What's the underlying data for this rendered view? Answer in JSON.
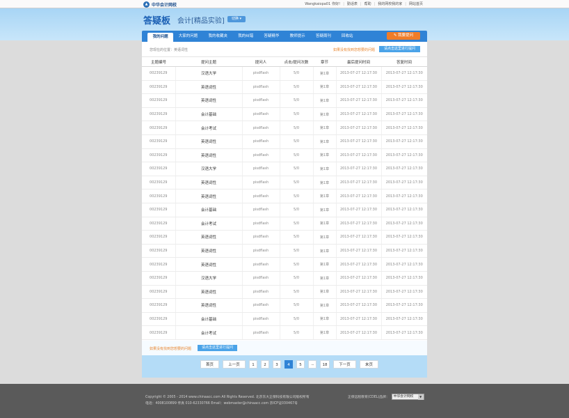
{
  "topbar": {
    "logo_text": "中华会计网校",
    "username": "Wangkaiopa01",
    "greeting": "你好!",
    "links": [
      "勤话表",
      "帮助",
      "我的网校我的家",
      "网站首页"
    ]
  },
  "header": {
    "board_title": "答疑板",
    "course_title": "会计[精品实验]",
    "switch_label": "切换"
  },
  "nav": {
    "tabs": [
      "我的问题",
      "大家的问题",
      "我的收藏夹",
      "我的纠错",
      "答疑精华",
      "教师提示",
      "答疑周刊",
      "回收站"
    ],
    "active": "我的问题",
    "ask_label": "我要提问"
  },
  "crumb": "您现在的位置：英语词性",
  "hint": "如果没有找到您想要的问题",
  "go_label": "请点击这里进行提问",
  "table": {
    "headers": [
      "主题编号",
      "提问主题",
      "提问人",
      "点击/提问次数",
      "章节",
      "最后提问时间",
      "答复时间"
    ],
    "rows": [
      [
        "00239129",
        "汉语大学",
        "pisdflash",
        "5/0",
        "第1章",
        "2013-07-27 12:17:30",
        "2013-07-27 12:17:30"
      ],
      [
        "00239129",
        "英语词性",
        "pisdflash",
        "5/0",
        "第1章",
        "2013-07-27 12:17:30",
        "2013-07-27 12:17:30"
      ],
      [
        "00239129",
        "英语词性",
        "pisdflash",
        "5/0",
        "第1章",
        "2013-07-27 12:17:30",
        "2013-07-27 12:17:30"
      ],
      [
        "00239129",
        "会计基础",
        "pisdflash",
        "5/0",
        "第1章",
        "2013-07-27 12:17:30",
        "2013-07-27 12:17:30"
      ],
      [
        "00239129",
        "会计考试",
        "pisdflash",
        "5/0",
        "第1章",
        "2013-07-27 12:17:30",
        "2013-07-27 12:17:30"
      ],
      [
        "00239129",
        "英语词性",
        "pisdflash",
        "5/0",
        "第1章",
        "2013-07-27 12:17:30",
        "2013-07-27 12:17:30"
      ],
      [
        "00239129",
        "英语词性",
        "pisdflash",
        "5/0",
        "第1章",
        "2013-07-27 12:17:30",
        "2013-07-27 12:17:30"
      ],
      [
        "00239129",
        "汉语大学",
        "pisdflash",
        "5/0",
        "第1章",
        "2013-07-27 12:17:30",
        "2013-07-27 12:17:30"
      ],
      [
        "00239129",
        "英语词性",
        "pisdflash",
        "5/0",
        "第1章",
        "2013-07-27 12:17:30",
        "2013-07-27 12:17:30"
      ],
      [
        "00239129",
        "英语词性",
        "pisdflash",
        "5/0",
        "第1章",
        "2013-07-27 12:17:30",
        "2013-07-27 12:17:30"
      ],
      [
        "00239129",
        "会计基础",
        "pisdflash",
        "5/0",
        "第1章",
        "2013-07-27 12:17:30",
        "2013-07-27 12:17:30"
      ],
      [
        "00239129",
        "会计考试",
        "pisdflash",
        "5/0",
        "第1章",
        "2013-07-27 12:17:30",
        "2013-07-27 12:17:30"
      ],
      [
        "00239129",
        "英语词性",
        "pisdflash",
        "5/0",
        "第1章",
        "2013-07-27 12:17:30",
        "2013-07-27 12:17:30"
      ],
      [
        "00239129",
        "英语词性",
        "pisdflash",
        "5/0",
        "第1章",
        "2013-07-27 12:17:30",
        "2013-07-27 12:17:30"
      ],
      [
        "00239129",
        "英语词性",
        "pisdflash",
        "5/0",
        "第1章",
        "2013-07-27 12:17:30",
        "2013-07-27 12:17:30"
      ],
      [
        "00239129",
        "汉语大学",
        "pisdflash",
        "5/0",
        "第1章",
        "2013-07-27 12:17:30",
        "2013-07-27 12:17:30"
      ],
      [
        "00239129",
        "英语词性",
        "pisdflash",
        "5/0",
        "第1章",
        "2013-07-27 12:17:30",
        "2013-07-27 12:17:30"
      ],
      [
        "00239129",
        "英语词性",
        "pisdflash",
        "5/0",
        "第1章",
        "2013-07-27 12:17:30",
        "2013-07-27 12:17:30"
      ],
      [
        "00239129",
        "会计基础",
        "pisdflash",
        "5/0",
        "第1章",
        "2013-07-27 12:17:30",
        "2013-07-27 12:17:30"
      ],
      [
        "00239129",
        "会计考试",
        "pisdflash",
        "5/0",
        "第1章",
        "2013-07-27 12:17:30",
        "2013-07-27 12:17:30"
      ]
    ]
  },
  "bottom": {
    "hint": "如果没有找到您想要的问题",
    "go_label": "请点击这里进行提问"
  },
  "pager": {
    "first": "首页",
    "prev": "上一页",
    "pages": [
      "1",
      "2",
      "3",
      "4",
      "5"
    ],
    "current": "4",
    "dots": "···",
    "last_page": "18",
    "next": "下一页",
    "end": "末页"
  },
  "footer": {
    "line1": "Copyright © 2005 - 2014 www.chinaacc.com All Rights Reserved.    北京东大正保科技有限公司版权所有",
    "line2": "电话：4008100899  传真 010-62330766  Email：webmaster@chinaacc.com  京ICP证030467号",
    "right_label": "正保远程教育(CDEL)品牌：",
    "select_value": "中华会计网校"
  },
  "colors": {
    "nav_blue": "#2f83d6",
    "header_blue": "#a8d5f5",
    "accent_orange": "#f07c28",
    "hint_orange": "#e8852e",
    "footer_gray": "#5a5a5a"
  }
}
